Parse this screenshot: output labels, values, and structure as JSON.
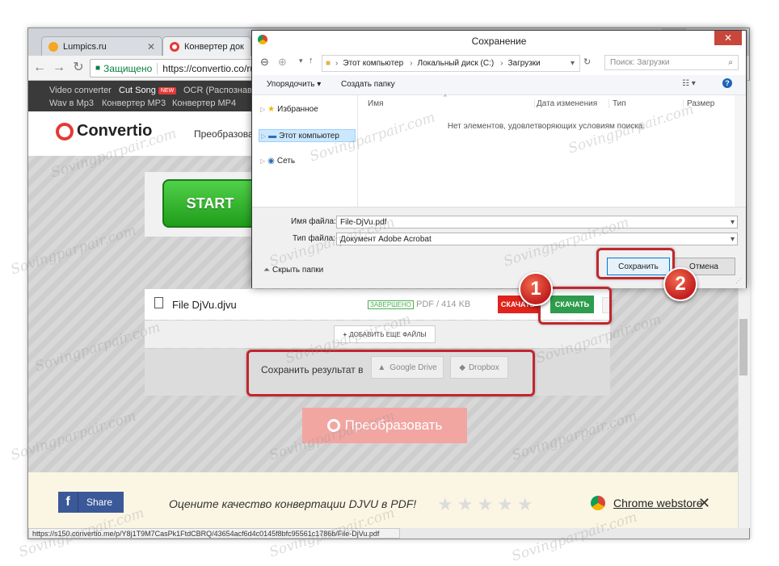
{
  "browser": {
    "tabs": [
      {
        "label": "Lumpics.ru",
        "active": false,
        "color": "#f5a623"
      },
      {
        "label": "Конвертер документ",
        "active": true,
        "color": "#e53935"
      }
    ],
    "address": {
      "secure_label": "Защищено",
      "url": "https://convertio.co/ru"
    },
    "status_url": "https://s150.convertio.me/p/Y8j1T9M7CasPk1FtdCBRQ/43654acf6d4c0145f8bfc95561c1786b/File-DjVu.pdf"
  },
  "site": {
    "nav": {
      "row1": [
        "Video converter",
        "Cut Song",
        "OCR (Распознаван"
      ],
      "new_badge": "NEW",
      "row2": [
        "Wav в Mp3",
        "Конвертер MP3",
        "Конвертер MP4"
      ]
    },
    "logo_text": "Convertio",
    "header_link": "Преобразоват",
    "start_button": "START",
    "file": {
      "name": "File DjVu.djvu",
      "status": "ЗАВЕРШЕНО",
      "info": "PDF / 414 KB",
      "red_button": "СКАЧАТЬ",
      "download_button": "СКАЧАТЬ"
    },
    "add_files": "ДОБАВИТЬ ЕЩЕ ФАЙЛЫ",
    "save_result_label": "Сохранить результат в",
    "google_drive": "Google Drive",
    "dropbox": "Dropbox",
    "convert_button": "Преобразовать",
    "footer": {
      "share": "Share",
      "rate_text": "Оцените качество конвертации DJVU в PDF!",
      "stars": "★★★★★",
      "webstore": "Chrome webstore"
    }
  },
  "dialog": {
    "title": "Сохранение",
    "path": [
      "Этот компьютер",
      "Локальный диск (C:)",
      "Загрузки"
    ],
    "search_placeholder": "Поиск: Загрузки",
    "organize": "Упорядочить",
    "new_folder": "Создать папку",
    "nav_items": [
      {
        "label": "Избранное",
        "icon": "star-icon",
        "selected": false
      },
      {
        "label": "Этот компьютер",
        "icon": "computer-icon",
        "selected": true
      },
      {
        "label": "Сеть",
        "icon": "network-icon",
        "selected": false
      }
    ],
    "columns": [
      "Имя",
      "Дата изменения",
      "Тип",
      "Размер"
    ],
    "empty_message": "Нет элементов, удовлетворяющих условиям поиска.",
    "filename_label": "Имя файла:",
    "filename_value": "File-DjVu.pdf",
    "filetype_label": "Тип файла:",
    "filetype_value": "Документ Adobe Acrobat",
    "hide_folders": "Скрыть папки",
    "save_button": "Сохранить",
    "cancel_button": "Отмена"
  },
  "markers": {
    "one": "1",
    "two": "2"
  },
  "watermark": "Sovingparpair.com",
  "colors": {
    "highlight": "#c1272d",
    "marker": "#d3241f",
    "download_green": "#2e9c4d",
    "accent_red": "#e53935"
  }
}
